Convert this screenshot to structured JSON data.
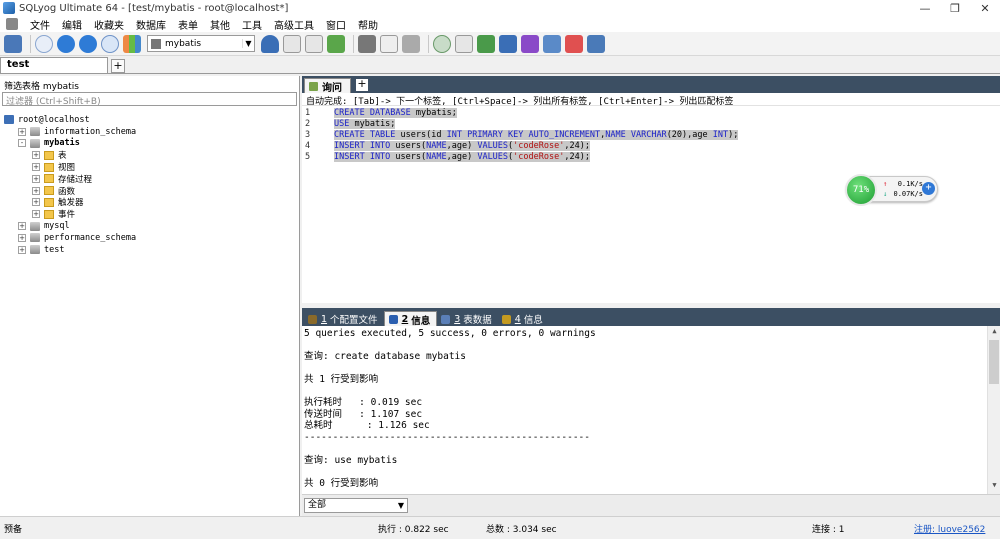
{
  "window": {
    "title": "SQLyog Ultimate 64 - [test/mybatis - root@localhost*]",
    "controls": [
      "—",
      "❐",
      "✕"
    ]
  },
  "menu": [
    "文件",
    "编辑",
    "收藏夹",
    "数据库",
    "表单",
    "其他",
    "工具",
    "高级工具",
    "窗口",
    "帮助"
  ],
  "toolbar": {
    "database_selected": "mybatis"
  },
  "connection_tab": "test",
  "left_panel": {
    "filter_label": "筛选表格 mybatis",
    "filter_placeholder": "过滤器 (Ctrl+Shift+B)",
    "tree": [
      {
        "label": "root@localhost",
        "level": 0,
        "expand": "",
        "icon": "server"
      },
      {
        "label": "information_schema",
        "level": 1,
        "expand": "+",
        "icon": "db"
      },
      {
        "label": "mybatis",
        "level": 1,
        "expand": "-",
        "icon": "db",
        "bold": true
      },
      {
        "label": "表",
        "level": 2,
        "expand": "+",
        "icon": "folder"
      },
      {
        "label": "视图",
        "level": 2,
        "expand": "+",
        "icon": "folder"
      },
      {
        "label": "存储过程",
        "level": 2,
        "expand": "+",
        "icon": "folder"
      },
      {
        "label": "函数",
        "level": 2,
        "expand": "+",
        "icon": "folder"
      },
      {
        "label": "触发器",
        "level": 2,
        "expand": "+",
        "icon": "folder"
      },
      {
        "label": "事件",
        "level": 2,
        "expand": "+",
        "icon": "folder"
      },
      {
        "label": "mysql",
        "level": 1,
        "expand": "+",
        "icon": "db"
      },
      {
        "label": "performance_schema",
        "level": 1,
        "expand": "+",
        "icon": "db"
      },
      {
        "label": "test",
        "level": 1,
        "expand": "+",
        "icon": "db"
      }
    ]
  },
  "query_tab": "询问",
  "autocomplete_hint": "自动完成: [Tab]-> 下一个标签, [Ctrl+Space]-> 列出所有标签, [Ctrl+Enter]-> 列出匹配标签",
  "editor": {
    "lines": [
      {
        "num": "1",
        "tokens": [
          {
            "t": "CREATE DATABASE",
            "c": "kw"
          },
          {
            "t": " mybatis;",
            "c": ""
          }
        ]
      },
      {
        "num": "2",
        "tokens": [
          {
            "t": "USE",
            "c": "kw"
          },
          {
            "t": " mybatis;",
            "c": ""
          }
        ]
      },
      {
        "num": "3",
        "tokens": [
          {
            "t": "CREATE TABLE",
            "c": "kw"
          },
          {
            "t": " users(id ",
            "c": ""
          },
          {
            "t": "INT PRIMARY KEY AUTO_INCREMENT",
            "c": "kw"
          },
          {
            "t": ",",
            "c": ""
          },
          {
            "t": "NAME VARCHAR",
            "c": "kw"
          },
          {
            "t": "(20),age ",
            "c": ""
          },
          {
            "t": "INT",
            "c": "kw"
          },
          {
            "t": ");",
            "c": ""
          }
        ]
      },
      {
        "num": "4",
        "tokens": [
          {
            "t": "INSERT INTO",
            "c": "kw"
          },
          {
            "t": " users(",
            "c": ""
          },
          {
            "t": "NAME",
            "c": "kw"
          },
          {
            "t": ",age) ",
            "c": ""
          },
          {
            "t": "VALUES",
            "c": "kw"
          },
          {
            "t": "(",
            "c": ""
          },
          {
            "t": "'codeRose'",
            "c": "str"
          },
          {
            "t": ",24);",
            "c": ""
          }
        ]
      },
      {
        "num": "5",
        "tokens": [
          {
            "t": "INSERT INTO",
            "c": "kw"
          },
          {
            "t": " users(",
            "c": ""
          },
          {
            "t": "NAME",
            "c": "kw"
          },
          {
            "t": ",age) ",
            "c": ""
          },
          {
            "t": "VALUES",
            "c": "kw"
          },
          {
            "t": "(",
            "c": ""
          },
          {
            "t": "'codeRose'",
            "c": "str"
          },
          {
            "t": ",24);",
            "c": ""
          }
        ]
      }
    ]
  },
  "net_monitor": {
    "percent": "71%",
    "up": "0.1K/s",
    "down": "0.07K/s"
  },
  "result_tabs": [
    {
      "key": "1",
      "label": "个配置文件",
      "active": false,
      "color": "#8a6a2a"
    },
    {
      "key": "2",
      "label": "信息",
      "active": true,
      "color": "#2b5fb0"
    },
    {
      "key": "3",
      "label": "表数据",
      "active": false,
      "color": "#5a7fb8"
    },
    {
      "key": "4",
      "label": "信息",
      "active": false,
      "color": "#c49a20"
    }
  ],
  "messages": [
    "5 queries executed, 5 success, 0 errors, 0 warnings",
    "",
    "查询: create database mybatis",
    "",
    "共 1 行受到影响",
    "",
    "执行耗时   : 0.019 sec",
    "传送时间   : 1.107 sec",
    "总耗时      : 1.126 sec",
    "--------------------------------------------------",
    "",
    "查询: use mybatis",
    "",
    "共 0 行受到影响"
  ],
  "message_filter": "全部",
  "status": {
    "left": "预备",
    "exec": "执行 : 0.822 sec",
    "total": "总数 : 3.034 sec",
    "conn": "连接 : 1",
    "user": "注册: luove2562"
  }
}
